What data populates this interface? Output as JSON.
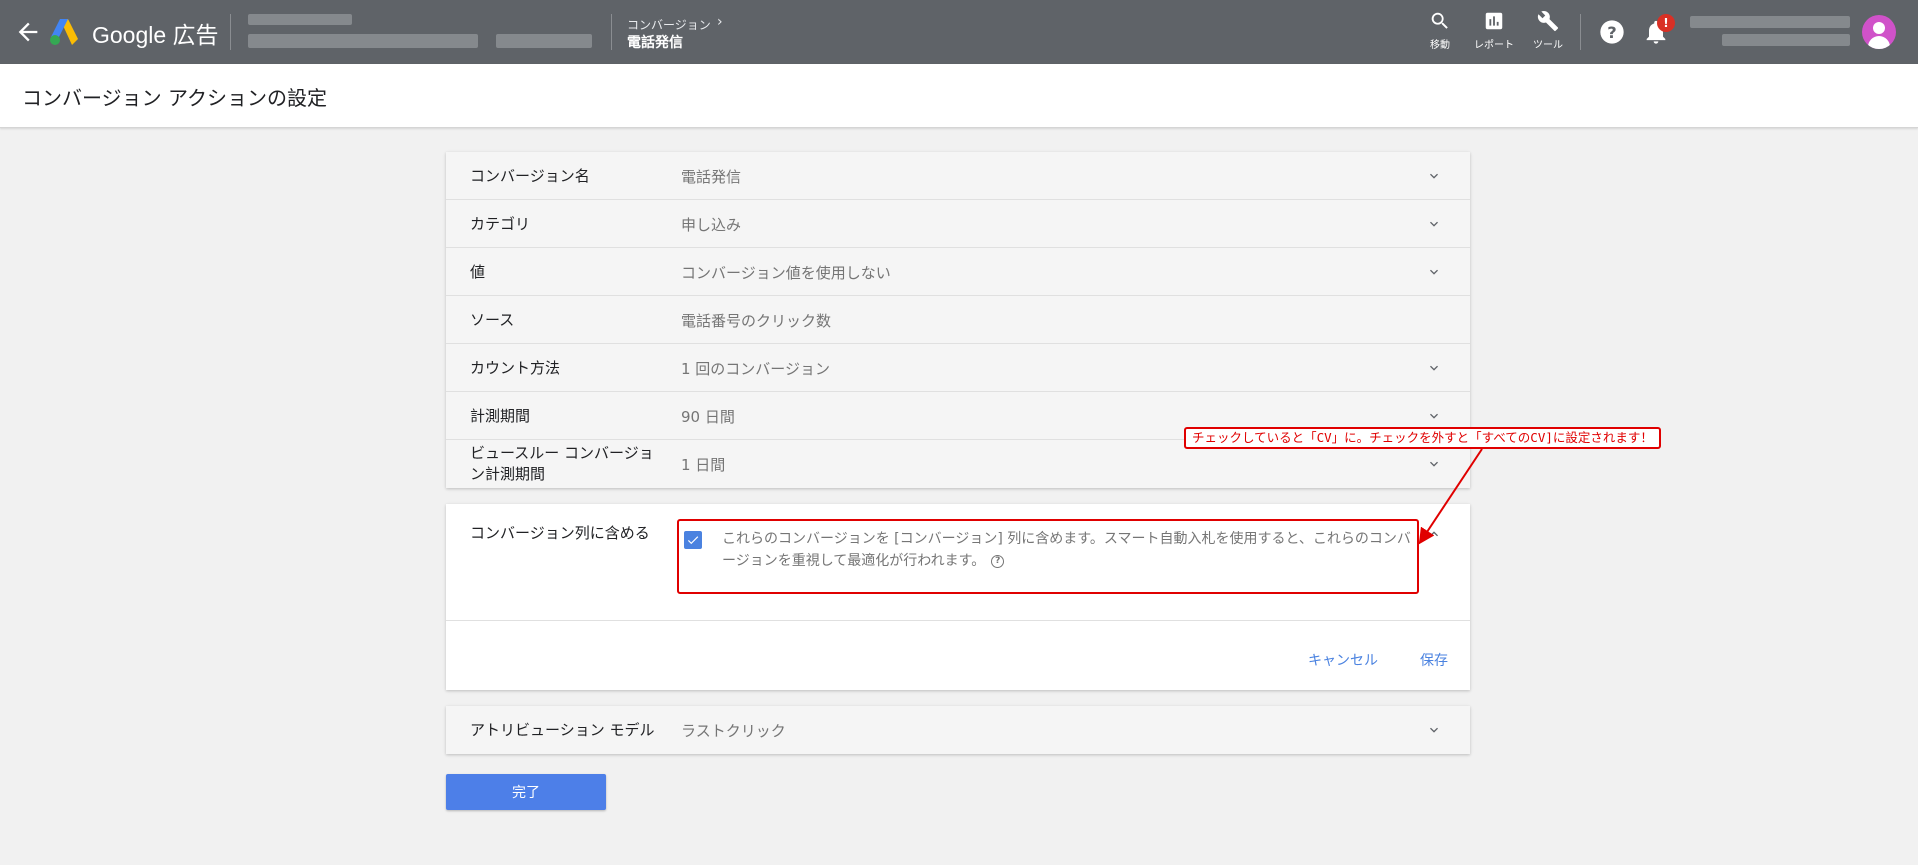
{
  "topbar": {
    "brand": "Google 広告",
    "breadcrumb_parent": "コンバージョン",
    "breadcrumb_current": "電話発信",
    "tools": [
      {
        "label": "移動",
        "icon": "search-icon"
      },
      {
        "label": "レポート",
        "icon": "report-icon"
      },
      {
        "label": "ツール",
        "icon": "wrench-icon"
      }
    ],
    "notification_badge": "!"
  },
  "page": {
    "title": "コンバージョン アクションの設定"
  },
  "settings": {
    "rows": [
      {
        "label": "コンバージョン名",
        "value": "電話発信"
      },
      {
        "label": "カテゴリ",
        "value": "申し込み"
      },
      {
        "label": "値",
        "value": "コンバージョン値を使用しない"
      },
      {
        "label": "ソース",
        "value": "電話番号のクリック数"
      },
      {
        "label": "カウント方法",
        "value": "1 回のコンバージョン"
      },
      {
        "label": "計測期間",
        "value": "90 日間"
      },
      {
        "label": "ビュースルー コンバージョン計測期間",
        "value": "1 日間"
      }
    ]
  },
  "include": {
    "label": "コンバージョン列に含める",
    "checked": true,
    "text": "これらのコンバージョンを [コンバージョン] 列に含めます。スマート自動入札を使用すると、これらのコンバージョンを重視して最適化が行われます。",
    "cancel_label": "キャンセル",
    "save_label": "保存"
  },
  "attribution": {
    "label": "アトリビューション モデル",
    "value": "ラストクリック"
  },
  "done_label": "完了",
  "annotation": {
    "text": "チェックしていると「CV」に。チェックを外すと「すべてのCV]に設定されます！",
    "color": "#e00000"
  },
  "colors": {
    "topbar": "#5f6368",
    "accent": "#4a82e0",
    "avatar": "#d052c9"
  }
}
